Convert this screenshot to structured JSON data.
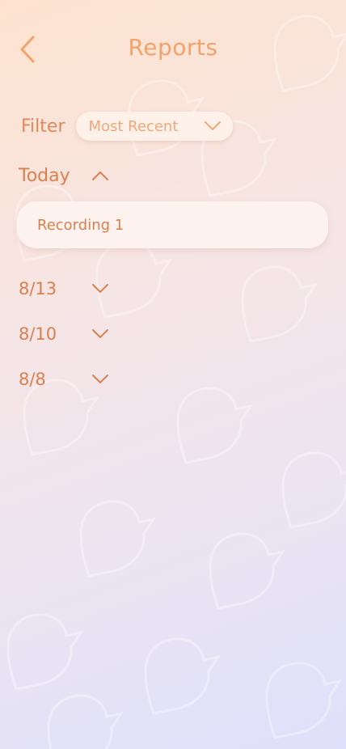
{
  "header": {
    "title": "Reports",
    "back_icon": "chevron-left-icon"
  },
  "filter": {
    "label": "Filter",
    "selected": "Most Recent",
    "dropdown_icon": "chevron-down-icon"
  },
  "groups": [
    {
      "label": "Today",
      "expanded": true,
      "items": [
        {
          "label": "Recording 1"
        }
      ]
    },
    {
      "label": "8/13",
      "expanded": false
    },
    {
      "label": "8/10",
      "expanded": false
    },
    {
      "label": "8/8",
      "expanded": false
    }
  ],
  "colors": {
    "accent": "#f2a26b",
    "text": "#d9804f",
    "card": "#fdf2ee"
  }
}
